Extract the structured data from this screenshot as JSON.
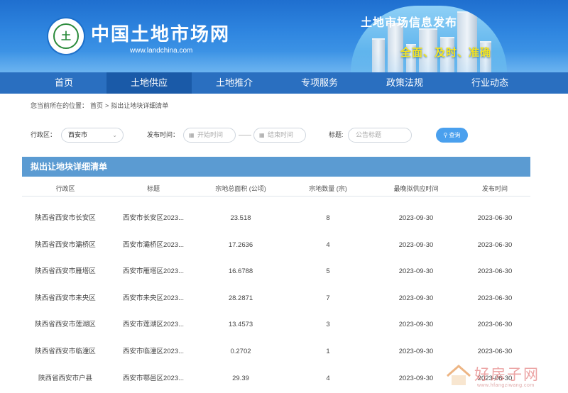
{
  "header": {
    "site_title": "中国土地市场网",
    "site_url": "www.landchina.com",
    "logo_text": "土",
    "banner_title": "土地市场信息发布",
    "banner_slogan": "全面、及时、准确"
  },
  "nav": {
    "items": [
      "首页",
      "土地供应",
      "土地推介",
      "专项服务",
      "政策法规",
      "行业动态"
    ],
    "active_index": 1
  },
  "breadcrumb": {
    "prefix": "您当前所在的位置：",
    "home": "首页",
    "separator": ">",
    "current": "拟出让地块详细清单"
  },
  "filters": {
    "region_label": "行政区：",
    "region_value": "西安市",
    "date_label": "发布时间：",
    "start_placeholder": "开始时间",
    "end_placeholder": "结束时间",
    "title_label": "标题:",
    "title_placeholder": "公告标题",
    "search_label": "查询"
  },
  "list": {
    "heading": "拟出让地块详细清单",
    "columns": [
      "行政区",
      "标题",
      "宗地总面积 (公顷)",
      "宗地数量 (宗)",
      "最晚拟供应时间",
      "发布时间"
    ],
    "rows": [
      [
        "陕西省西安市长安区",
        "西安市长安区2023...",
        "23.518",
        "8",
        "2023-09-30",
        "2023-06-30"
      ],
      [
        "陕西省西安市灞桥区",
        "西安市灞桥区2023...",
        "17.2636",
        "4",
        "2023-09-30",
        "2023-06-30"
      ],
      [
        "陕西省西安市雁塔区",
        "西安市雁塔区2023...",
        "16.6788",
        "5",
        "2023-09-30",
        "2023-06-30"
      ],
      [
        "陕西省西安市未央区",
        "西安市未央区2023...",
        "28.2871",
        "7",
        "2023-09-30",
        "2023-06-30"
      ],
      [
        "陕西省西安市莲湖区",
        "西安市莲湖区2023...",
        "13.4573",
        "3",
        "2023-09-30",
        "2023-06-30"
      ],
      [
        "陕西省西安市临潼区",
        "西安市临潼区2023...",
        "0.2702",
        "1",
        "2023-09-30",
        "2023-06-30"
      ],
      [
        "陕西省西安市户县",
        "西安市鄠邑区2023...",
        "29.39",
        "4",
        "2023-09-30",
        "2023-06-30"
      ]
    ]
  },
  "watermark": {
    "text": "好房子网",
    "url": "www.hfangziwang.com"
  },
  "colors": {
    "header_blue": "#2f86e0",
    "nav_blue": "#2a6fc0",
    "panel_blue": "#5b9bd2",
    "button_blue": "#4aa0ee",
    "slogan_yellow": "#f7e41c"
  }
}
